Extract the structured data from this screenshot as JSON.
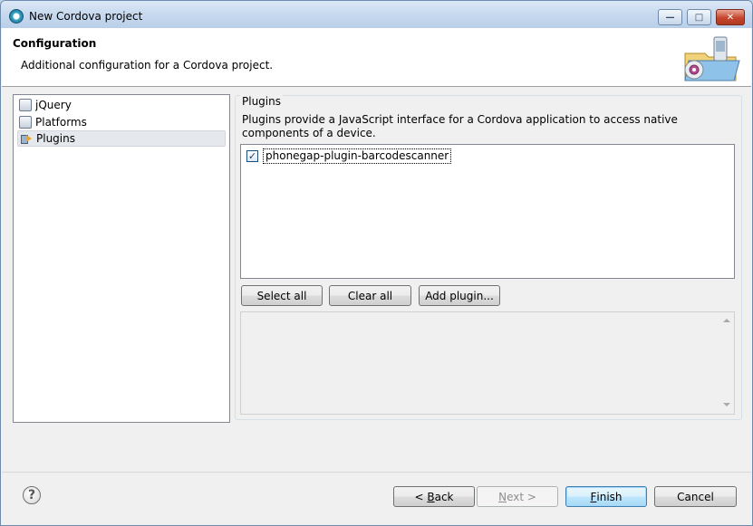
{
  "window": {
    "title": "New Cordova project",
    "icon": "cordova-app-icon"
  },
  "header": {
    "title": "Configuration",
    "description": "Additional configuration for a Cordova project."
  },
  "tree": {
    "items": [
      {
        "label": "jQuery",
        "icon": "jquery-page-icon"
      },
      {
        "label": "Platforms",
        "icon": "platforms-icon"
      },
      {
        "label": "Plugins",
        "icon": "plugin-icon",
        "selected": true
      }
    ]
  },
  "plugins": {
    "group_label": "Plugins",
    "description": "Plugins provide a JavaScript interface for a Cordova application to access native components of a device.",
    "list": [
      {
        "label": "phonegap-plugin-barcodescanner",
        "checked": true
      }
    ],
    "buttons": {
      "select_all": "Select all",
      "clear_all": "Clear all",
      "add_plugin": "Add plugin..."
    }
  },
  "footer": {
    "back_prefix": "< ",
    "back_mnemonic": "B",
    "back_rest": "ack",
    "next_mnemonic": "N",
    "next_rest": "ext >",
    "finish_mnemonic": "F",
    "finish_rest": "inish",
    "cancel": "Cancel"
  },
  "colors": {
    "titlebar": "#c7d9ee",
    "close_button": "#c5452c",
    "default_button": "#3c7fb1"
  }
}
